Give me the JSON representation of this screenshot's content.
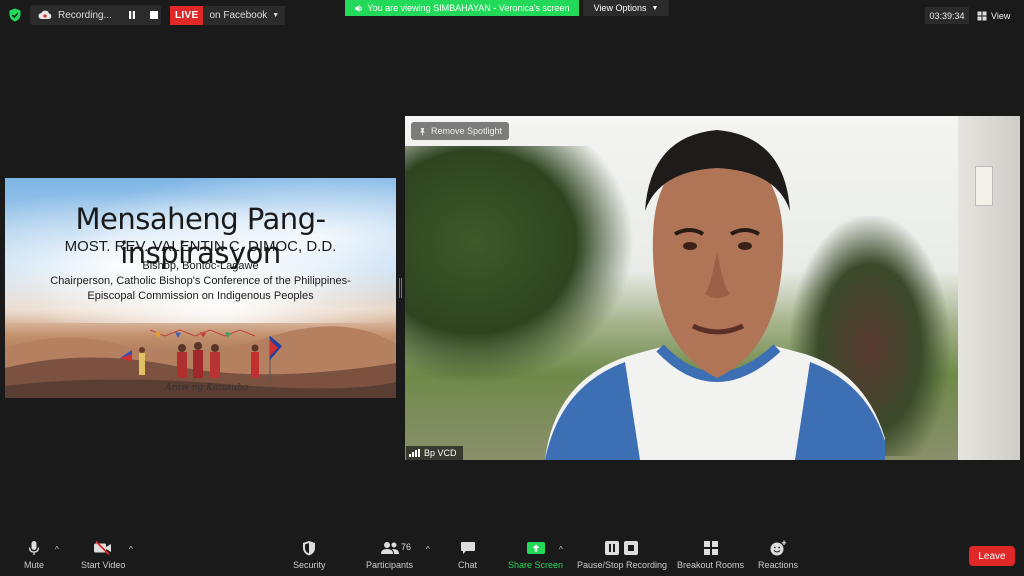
{
  "top": {
    "recording_label": "Recording...",
    "live_label": "LIVE",
    "live_target": "on Facebook",
    "viewing_banner": "You are viewing SIMBAHAYAN - Veronica's screen",
    "view_options": "View Options",
    "timer": "03:39:34",
    "view_label": "View"
  },
  "slide": {
    "title": "Mensaheng Pang-inspirasyon",
    "name": "MOST. REV. VALENTIN C. DIMOC, D.D.",
    "line1": "Bishop, Bontoc-Lagawe",
    "line2": "Chairperson, Catholic Bishop's Conference of the Philippines-",
    "line3": "Episcopal Commission on Indigenous Peoples",
    "signature": "Araw ng Katutubo"
  },
  "video": {
    "spotlight_label": "Remove Spotlight",
    "participant_name": "Bp VCD"
  },
  "toolbar": {
    "mute": "Mute",
    "start_video": "Start Video",
    "security": "Security",
    "participants": "Participants",
    "participants_count": "76",
    "chat": "Chat",
    "share_screen": "Share Screen",
    "pause_recording": "Pause/Stop Recording",
    "breakout": "Breakout Rooms",
    "reactions": "Reactions",
    "leave": "Leave"
  },
  "colors": {
    "live_red": "#e02828",
    "zoom_green": "#23d959",
    "background": "#1a1a1a"
  }
}
